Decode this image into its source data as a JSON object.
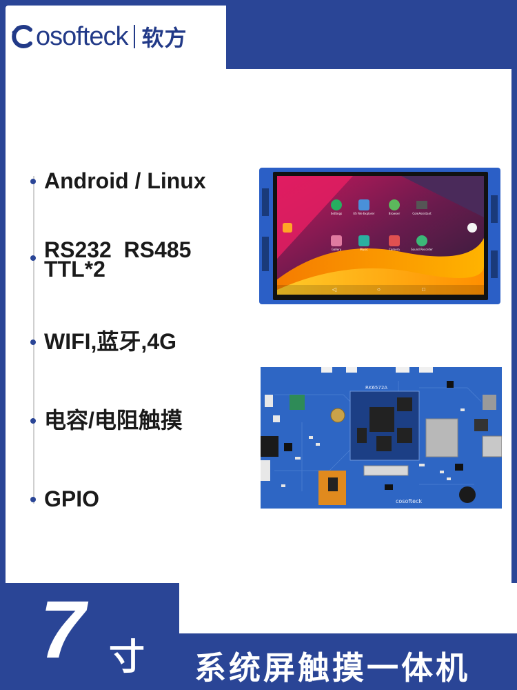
{
  "brand": {
    "logo_text": "osofteck",
    "logo_initial": "C",
    "logo_cn": "软方",
    "color": "#223a88"
  },
  "features": [
    {
      "text": "Android / Linux"
    },
    {
      "text_line1": "RS232  RS485",
      "text_line2": "TTL*2"
    },
    {
      "text": "WIFI,蓝牙,4G"
    },
    {
      "text": "电容/电阻触摸"
    },
    {
      "text": "GPIO"
    }
  ],
  "screen_apps": [
    {
      "label": "Settings",
      "icon": "gear-icon",
      "color": "#27ae60"
    },
    {
      "label": "ES File Explorer",
      "icon": "folder-icon",
      "color": "#4a90d9"
    },
    {
      "label": "Browser",
      "icon": "globe-icon",
      "color": "#5cb85c"
    },
    {
      "label": "ComAssistant",
      "icon": "chip-icon",
      "color": "#555555"
    },
    {
      "label": "Gallery",
      "icon": "image-icon",
      "color": "#e07aa0"
    },
    {
      "label": "Music",
      "icon": "music-icon",
      "color": "#2ab0a0"
    },
    {
      "label": "Camera",
      "icon": "camera-icon",
      "color": "#e05050"
    },
    {
      "label": "Sound Recorder",
      "icon": "mic-icon",
      "color": "#3cb878"
    }
  ],
  "board": {
    "model": "RK6572A",
    "brand_print": "cosofteck"
  },
  "bottom": {
    "size": "7",
    "unit": "寸",
    "slogan": "系统屏触摸一体机"
  },
  "colors": {
    "frame": "#2a4596",
    "board": "#2e66c4"
  }
}
